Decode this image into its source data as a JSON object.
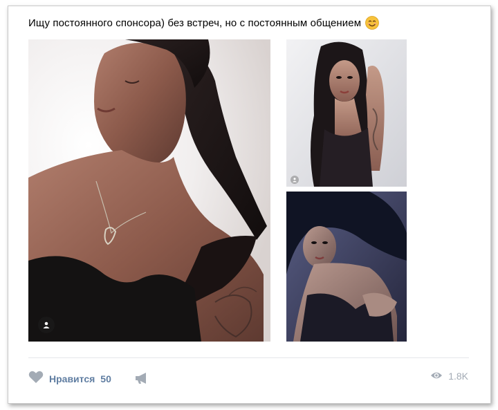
{
  "post": {
    "text": "Ищу постоянного спонсора) без встреч, но с постоянным общением",
    "emoji_icon": "smiling-face-icon"
  },
  "photos": [
    {
      "name": "photo-main",
      "description_icon": "user-icon"
    },
    {
      "name": "photo-top",
      "description_icon": "user-icon"
    },
    {
      "name": "photo-bottom"
    }
  ],
  "actions": {
    "like_label": "Нравится",
    "like_count": "50",
    "like_icon": "heart-icon",
    "share_icon": "megaphone-icon",
    "views_icon": "eye-icon",
    "views_count": "1.8K"
  },
  "colors": {
    "action_blue": "#5f7da1",
    "icon_gray": "#a3abb5",
    "divider": "#e4e6ea"
  }
}
